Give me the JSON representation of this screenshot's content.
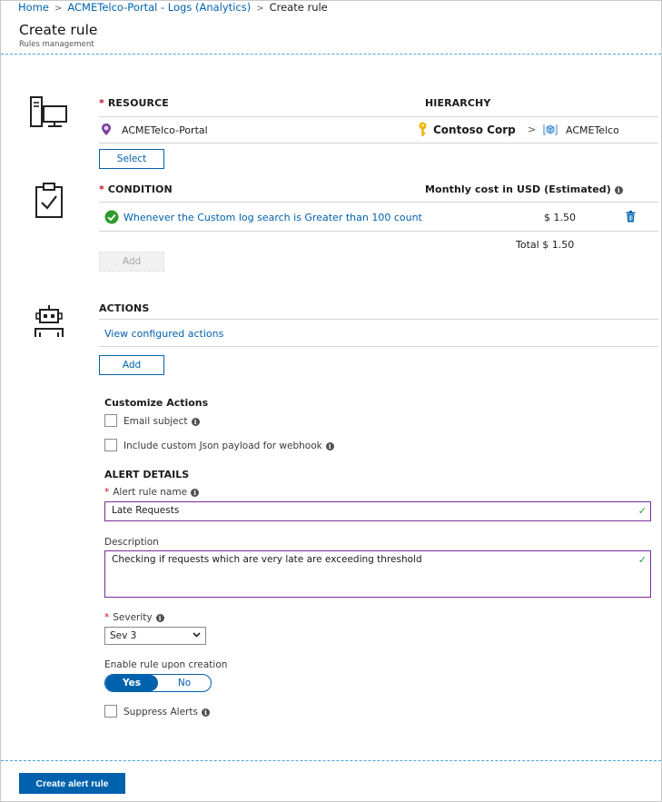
{
  "breadcrumb": [
    {
      "label": "Home"
    },
    {
      "label": "ACMETelco-Portal - Logs (Analytics)"
    },
    {
      "label": "Create rule"
    }
  ],
  "page": {
    "title": "Create rule",
    "subtitle": "Rules management"
  },
  "resource": {
    "label": "RESOURCE",
    "hierarchy_label": "HIERARCHY",
    "name": "ACMETelco-Portal",
    "hierarchy_root": "Contoso Corp",
    "hierarchy_child": "ACMETelco",
    "select_label": "Select"
  },
  "condition": {
    "label": "CONDITION",
    "cost_label": "Monthly cost in USD (Estimated)",
    "text": "Whenever the Custom log search is Greater than 100 count",
    "cost": "$ 1.50",
    "total_label": "Total",
    "total": "$ 1.50",
    "add_label": "Add"
  },
  "actions": {
    "label": "ACTIONS",
    "view_link": "View configured actions",
    "add_label": "Add",
    "customize_title": "Customize Actions",
    "email_subject": "Email subject",
    "custom_json": "Include custom Json payload for webhook"
  },
  "alert": {
    "section_title": "ALERT DETAILS",
    "name_label": "Alert rule name",
    "name_value": "Late Requests",
    "desc_label": "Description",
    "desc_value": "Checking if requests which are very late are exceeding threshold",
    "severity_label": "Severity",
    "severity_value": "Sev 3",
    "enable_label": "Enable rule upon creation",
    "yes": "Yes",
    "no": "No",
    "suppress_label": "Suppress Alerts"
  },
  "footer": {
    "create_label": "Create alert rule"
  },
  "colors": {
    "accent": "#0062ad",
    "required": "#c50f1f",
    "success": "#2e9b2e",
    "input_border": "#7a2b9e"
  }
}
